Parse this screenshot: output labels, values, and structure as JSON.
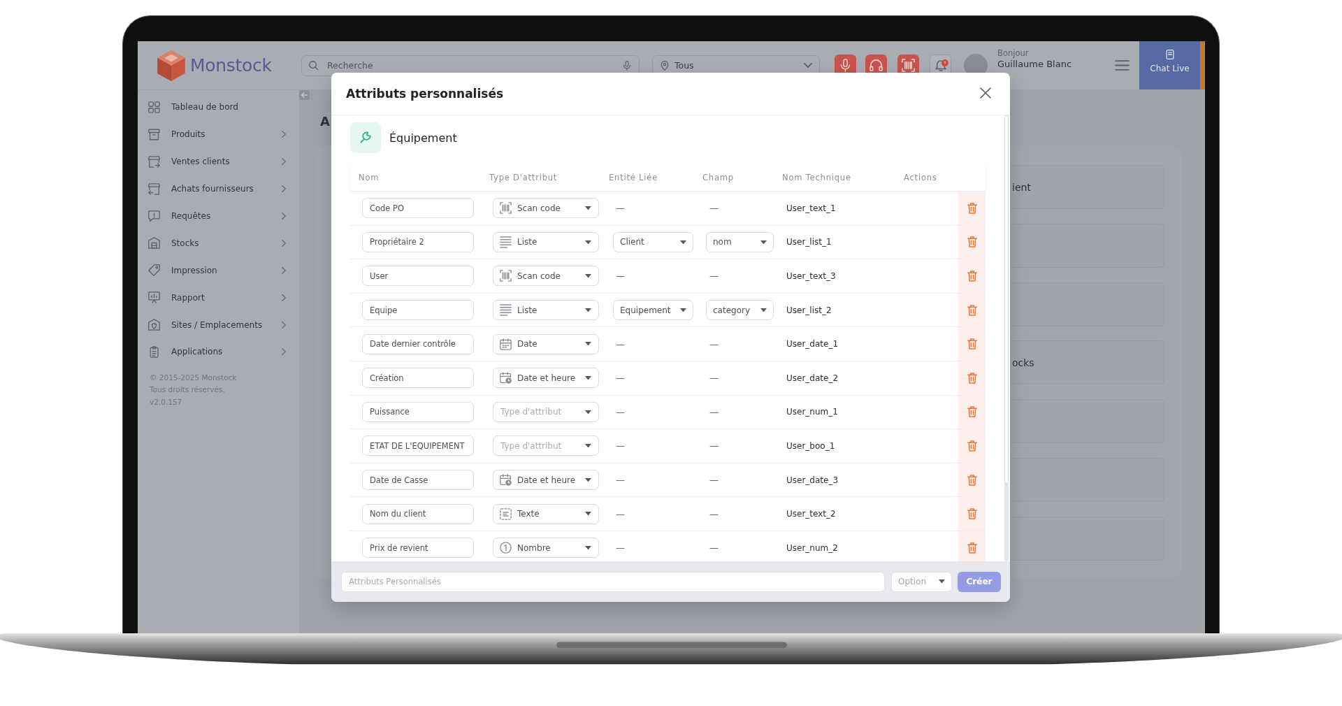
{
  "app_header": {
    "logo": "Monstock",
    "search": {
      "placeholder": "Recherche"
    },
    "location": {
      "value": "Tous"
    },
    "user": {
      "greeting": "Bonjour",
      "name": "Guillaume Blanc"
    },
    "chat_button": {
      "label": "Chat Live"
    }
  },
  "sidebar": {
    "items": [
      {
        "label": "Tableau de bord",
        "expandable": false
      },
      {
        "label": "Produits",
        "expandable": true
      },
      {
        "label": "Ventes clients",
        "expandable": true
      },
      {
        "label": "Achats fournisseurs",
        "expandable": true
      },
      {
        "label": "Requêtes",
        "expandable": true
      },
      {
        "label": "Stocks",
        "expandable": true
      },
      {
        "label": "Impression",
        "expandable": true
      },
      {
        "label": "Rapport",
        "expandable": true
      },
      {
        "label": "Sites / Emplacements",
        "expandable": true
      },
      {
        "label": "Applications",
        "expandable": true
      }
    ],
    "footer": [
      "© 2015-2025 Monstock",
      "Tous droits réservés.",
      "v2.0.157"
    ]
  },
  "page": {
    "title": "A",
    "cards": [
      {
        "kind": "labelled",
        "label": "ient"
      },
      {
        "kind": "blank"
      },
      {
        "kind": "blank"
      },
      {
        "kind": "labelled",
        "label": "ocks"
      },
      {
        "kind": "blank"
      },
      {
        "kind": "blank"
      },
      {
        "kind": "blank"
      }
    ]
  },
  "modal": {
    "title": "Attributs personnalisés",
    "section": {
      "title": "Équipement"
    },
    "table": {
      "columns": [
        "Nom",
        "Type D'attribut",
        "Entité Liée",
        "Champ",
        "Nom Technique",
        "Actions"
      ],
      "rows": [
        {
          "name": "Code PO",
          "type": {
            "kind": "scan",
            "value": "Scan code"
          },
          "entity": {
            "kind": "none",
            "text": "—"
          },
          "field": {
            "kind": "none",
            "text": "—"
          },
          "technical_name": "User_text_1"
        },
        {
          "name": "Propriétaire 2",
          "type": {
            "kind": "list",
            "value": "Liste"
          },
          "entity": {
            "kind": "select",
            "value": "Client"
          },
          "field": {
            "kind": "select",
            "value": "nom"
          },
          "technical_name": "User_list_1"
        },
        {
          "name": "User",
          "type": {
            "kind": "scan",
            "value": "Scan code"
          },
          "entity": {
            "kind": "none",
            "text": "—"
          },
          "field": {
            "kind": "none",
            "text": "—"
          },
          "technical_name": "User_text_3"
        },
        {
          "name": "Equipe",
          "type": {
            "kind": "list",
            "value": "Liste"
          },
          "entity": {
            "kind": "select",
            "value": "Equipement"
          },
          "field": {
            "kind": "select",
            "value": "category"
          },
          "technical_name": "User_list_2"
        },
        {
          "name": "Date dernier contrôle",
          "type": {
            "kind": "date",
            "value": "Date"
          },
          "entity": {
            "kind": "none",
            "text": "—"
          },
          "field": {
            "kind": "none",
            "text": "—"
          },
          "technical_name": "User_date_1"
        },
        {
          "name": "Création",
          "type": {
            "kind": "datetime",
            "value": "Date et heure"
          },
          "entity": {
            "kind": "none",
            "text": "—"
          },
          "field": {
            "kind": "none",
            "text": "—"
          },
          "technical_name": "User_date_2"
        },
        {
          "name": "Puissance",
          "type": {
            "kind": "unset",
            "placeholder": "Type d'attribut"
          },
          "entity": {
            "kind": "none",
            "text": "—"
          },
          "field": {
            "kind": "none",
            "text": "—"
          },
          "technical_name": "User_num_1"
        },
        {
          "name": "ETAT DE L'EQUIPEMENT",
          "type": {
            "kind": "unset",
            "placeholder": "Type d'attribut"
          },
          "entity": {
            "kind": "none",
            "text": "—"
          },
          "field": {
            "kind": "none",
            "text": "—"
          },
          "technical_name": "User_boo_1"
        },
        {
          "name": "Date de Casse",
          "type": {
            "kind": "datetime",
            "value": "Date et heure"
          },
          "entity": {
            "kind": "none",
            "text": "—"
          },
          "field": {
            "kind": "none",
            "text": "—"
          },
          "technical_name": "User_date_3"
        },
        {
          "name": "Nom du client",
          "type": {
            "kind": "text",
            "value": "Texte"
          },
          "entity": {
            "kind": "none",
            "text": "—"
          },
          "field": {
            "kind": "none",
            "text": "—"
          },
          "technical_name": "User_text_2"
        },
        {
          "name": "Prix de revient",
          "type": {
            "kind": "number",
            "value": "Nombre"
          },
          "entity": {
            "kind": "none",
            "text": "—"
          },
          "field": {
            "kind": "none",
            "text": "—"
          },
          "technical_name": "User_num_2"
        }
      ]
    },
    "footer": {
      "name_field": {
        "placeholder": "Attributs Personnalisés"
      },
      "option_select": {
        "placeholder": "Option"
      },
      "create_button": {
        "label": "Créer",
        "disabled": true
      }
    }
  }
}
